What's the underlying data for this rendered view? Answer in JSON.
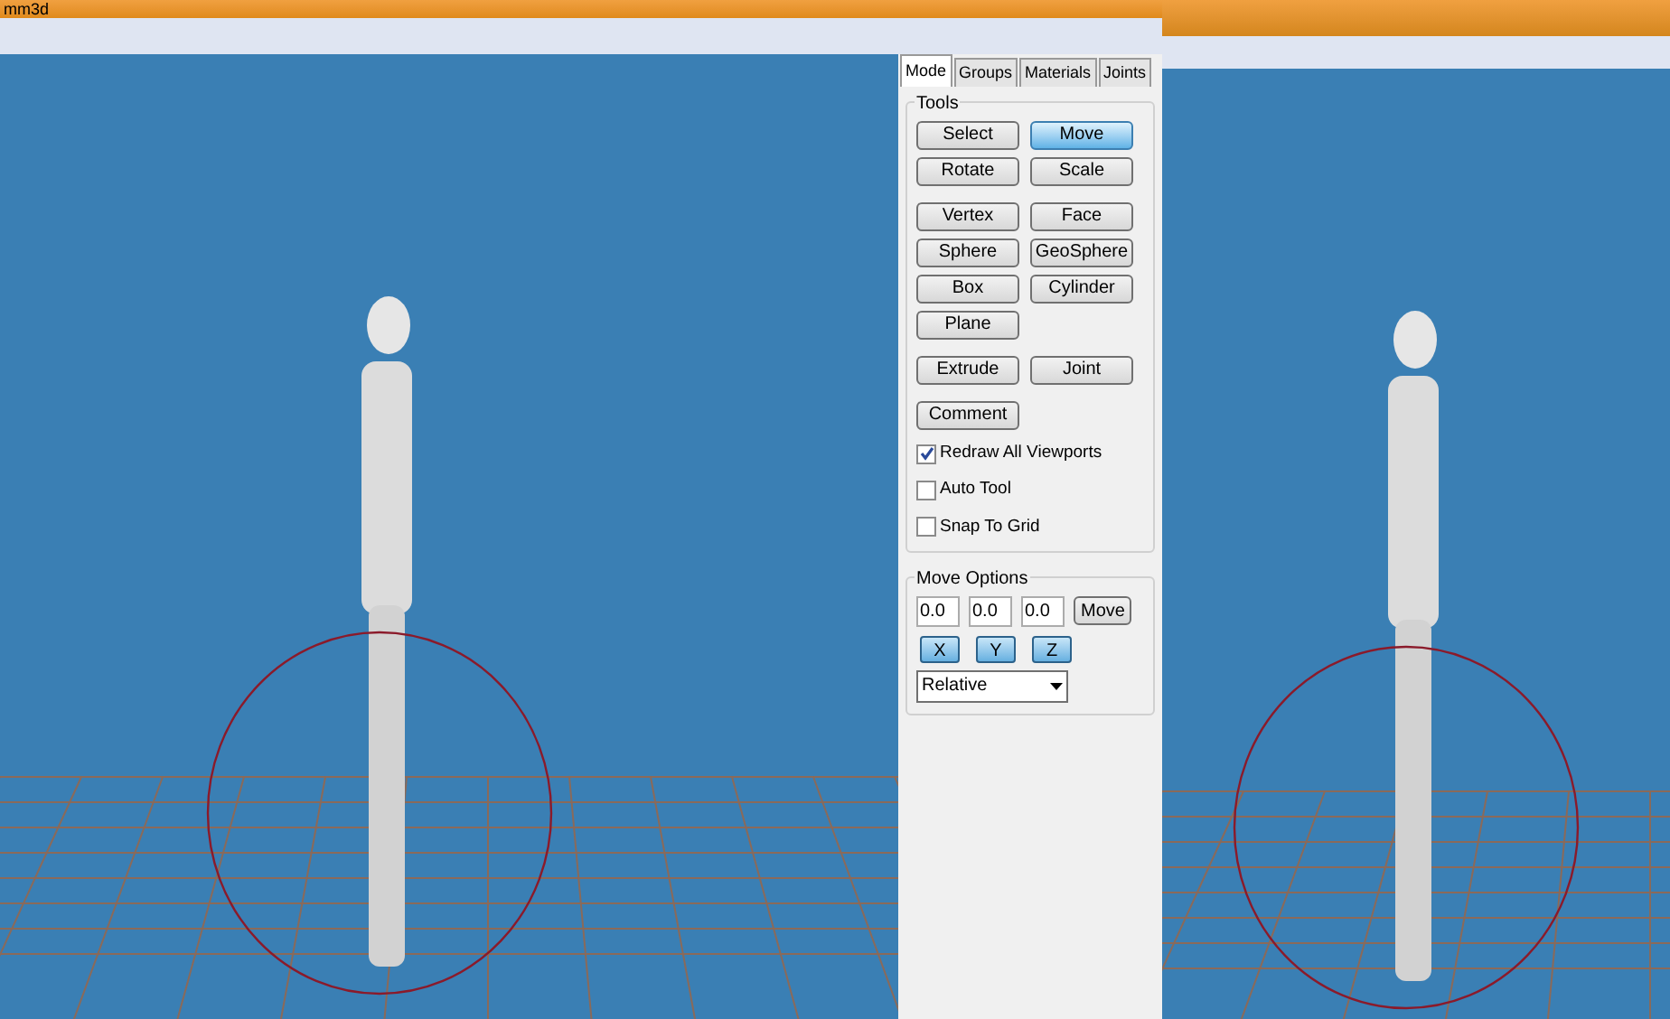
{
  "window": {
    "title": "mm3d"
  },
  "tabs": [
    {
      "label": "Mode",
      "selected": true
    },
    {
      "label": "Groups",
      "selected": false
    },
    {
      "label": "Materials",
      "selected": false
    },
    {
      "label": "Joints",
      "selected": false
    }
  ],
  "tools": {
    "title": "Tools",
    "groups": [
      [
        {
          "label": "Select",
          "selected": false
        },
        {
          "label": "Move",
          "selected": true
        },
        {
          "label": "Rotate",
          "selected": false
        },
        {
          "label": "Scale",
          "selected": false
        }
      ],
      [
        {
          "label": "Vertex",
          "selected": false
        },
        {
          "label": "Face",
          "selected": false
        },
        {
          "label": "Sphere",
          "selected": false
        },
        {
          "label": "GeoSphere",
          "selected": false
        },
        {
          "label": "Box",
          "selected": false
        },
        {
          "label": "Cylinder",
          "selected": false
        },
        {
          "label": "Plane",
          "selected": false
        }
      ],
      [
        {
          "label": "Extrude",
          "selected": false
        },
        {
          "label": "Joint",
          "selected": false
        }
      ],
      [
        {
          "label": "Comment",
          "selected": false
        }
      ]
    ],
    "options": [
      {
        "label": "Redraw All Viewports",
        "checked": true
      },
      {
        "label": "Auto Tool",
        "checked": false
      },
      {
        "label": "Snap To Grid",
        "checked": false
      }
    ]
  },
  "move_options": {
    "title": "Move Options",
    "fields": [
      "0.0",
      "0.0",
      "0.0"
    ],
    "apply": "Move",
    "axes": [
      {
        "label": "X",
        "selected": true
      },
      {
        "label": "Y",
        "selected": true
      },
      {
        "label": "Z",
        "selected": true
      }
    ],
    "mode": "Relative"
  }
}
